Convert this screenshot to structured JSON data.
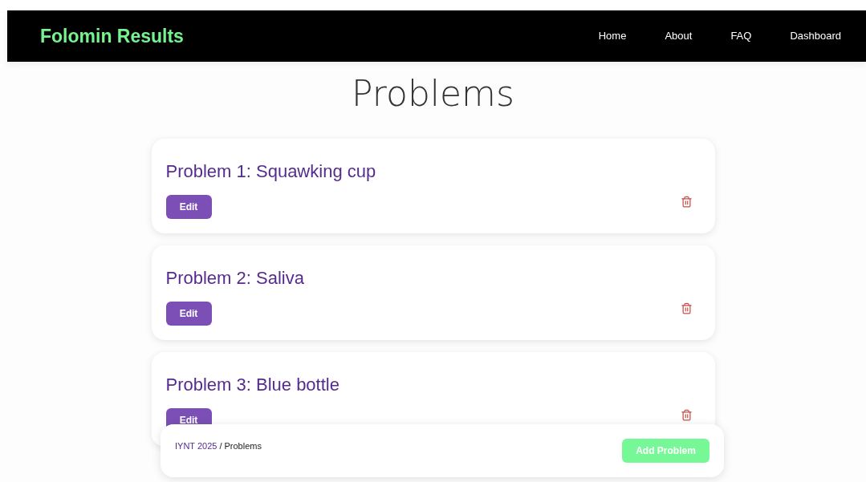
{
  "header": {
    "brand": "Folomin Results",
    "nav": [
      "Home",
      "About",
      "FAQ",
      "Dashboard"
    ]
  },
  "heading": "Problems",
  "problems": [
    {
      "title": "Problem 1: Squawking cup",
      "edit": "Edit"
    },
    {
      "title": "Problem 2: Saliva",
      "edit": "Edit"
    },
    {
      "title": "Problem 3: Blue bottle",
      "edit": "Edit"
    }
  ],
  "footer_bar": {
    "breadcrumb_link": "IYNT 2025",
    "breadcrumb_rest": "/ Problems",
    "add_button": "Add Problem"
  }
}
